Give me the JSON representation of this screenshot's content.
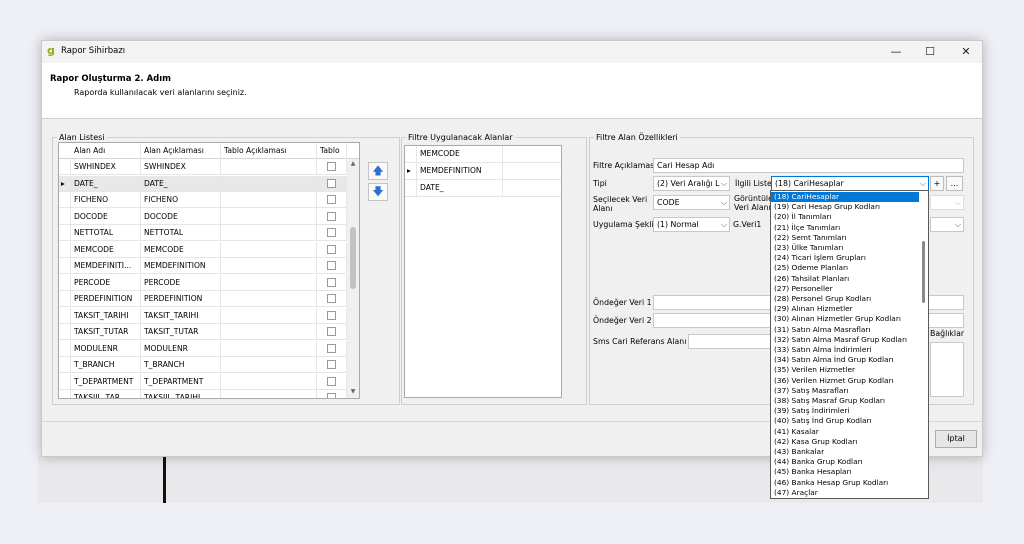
{
  "window": {
    "title": "Rapor Sihirbazı",
    "icon_letter": "g",
    "icons": [
      "minimize-icon",
      "maximize-icon",
      "close-icon"
    ],
    "minimize": "—",
    "maximize": "☐",
    "close": "✕"
  },
  "header": {
    "step_title": "Rapor Oluşturma 2. Adım",
    "step_desc": "Raporda kullanılacak veri alanlarını seçiniz."
  },
  "field_list": {
    "legend": "Alan Listesi",
    "columns": [
      "Alan Adı",
      "Alan Açıklaması",
      "Tablo Açıklaması",
      "Tablo"
    ],
    "rows": [
      {
        "name": "SWHINDEX",
        "desc": "SWHINDEX",
        "table_desc": "",
        "selected": false
      },
      {
        "name": "DATE_",
        "desc": "DATE_",
        "table_desc": "",
        "selected": true
      },
      {
        "name": "FICHENO",
        "desc": "FICHENO",
        "table_desc": "",
        "selected": false
      },
      {
        "name": "DOCODE",
        "desc": "DOCODE",
        "table_desc": "",
        "selected": false
      },
      {
        "name": "NETTOTAL",
        "desc": "NETTOTAL",
        "table_desc": "",
        "selected": false
      },
      {
        "name": "MEMCODE",
        "desc": "MEMCODE",
        "table_desc": "",
        "selected": false
      },
      {
        "name": "MEMDEFINITI...",
        "desc": "MEMDEFINITION",
        "table_desc": "",
        "selected": false
      },
      {
        "name": "PERCODE",
        "desc": "PERCODE",
        "table_desc": "",
        "selected": false
      },
      {
        "name": "PERDEFINITION",
        "desc": "PERDEFINITION",
        "table_desc": "",
        "selected": false
      },
      {
        "name": "TAKSIT_TARIHI",
        "desc": "TAKSIT_TARIHI",
        "table_desc": "",
        "selected": false
      },
      {
        "name": "TAKSIT_TUTAR",
        "desc": "TAKSIT_TUTAR",
        "table_desc": "",
        "selected": false
      },
      {
        "name": "MODULENR",
        "desc": "MODULENR",
        "table_desc": "",
        "selected": false
      },
      {
        "name": "T_BRANCH",
        "desc": "T_BRANCH",
        "table_desc": "",
        "selected": false
      },
      {
        "name": "T_DEPARTMENT",
        "desc": "T_DEPARTMENT",
        "table_desc": "",
        "selected": false
      },
      {
        "name": "TAKSIIL_TAR...",
        "desc": "TAKSIIL_TARIHI",
        "table_desc": "",
        "selected": false
      }
    ],
    "row_marker": "▸",
    "move_right_icon": "🡅",
    "move_down_icon": "🡇"
  },
  "filter_fields": {
    "legend": "Filtre Uygulanacak Alanlar",
    "rows": [
      {
        "name": "MEMCODE",
        "current": false
      },
      {
        "name": "MEMDEFINITION",
        "current": true
      },
      {
        "name": "DATE_",
        "current": false
      }
    ],
    "row_marker": "▸"
  },
  "filter_props": {
    "legend": "Filtre Alan Özellikleri",
    "desc_label": "Filtre Açıklaması",
    "desc_value": "Cari Hesap Adı",
    "type_label": "Tipi",
    "type_value": "(2) Veri Aralığı L",
    "related_list_label": "İlgili Liste",
    "related_list_value": "(18) CariHesaplar",
    "plus_button": "+",
    "more_button": "...",
    "selected_data_label_1": "Seçilecek Veri",
    "selected_data_label_2": "Alanı",
    "selected_data_value": "CODE",
    "display_label_1": "Görüntüle",
    "display_label_2": "Veri Alanı",
    "apply_label": "Uygulama Şekli",
    "apply_value": "(1) Normal",
    "gdata_label": "G.Veri1",
    "default1_label": "Öndeğer Veri 1",
    "default2_label": "Öndeğer Veri 2",
    "sms_label": "Sms Cari Referans Alanı",
    "headers_label": "Bağlıklar",
    "chevron": "⌵"
  },
  "dropdown_items": [
    "(18) CariHesaplar",
    "(19) Cari Hesap Grup Kodları",
    "(20) İl Tanımları",
    "(21) İlçe Tanımları",
    "(22) Semt Tanımları",
    "(23) Ülke Tanımları",
    "(24) Ticari İşlem Grupları",
    "(25) Odeme Planları",
    "(26) Tahsilat Planları",
    "(27) Personeller",
    "(28) Personel Grup Kodları",
    "(29) Alınan Hizmetler",
    "(30) Alınan Hizmetler Grup Kodları",
    "(31) Satın Alma Masrafları",
    "(32) Satın Alma Masraf Grup Kodları",
    "(33) Satın Alma İndirimleri",
    "(34) Satın Alma İnd Grup Kodları",
    "(35) Verilen Hizmetler",
    "(36) Verilen Hizmet Grup Kodları",
    "(37) Satış Masrafları",
    "(38) Satış Masraf Grup Kodları",
    "(39) Satış İndirimleri",
    "(40) Satış İnd Grup Kodları",
    "(41) Kasalar",
    "(42) Kasa Grup Kodları",
    "(43) Bankalar",
    "(44) Banka Grup Kodları",
    "(45) Banka Hesapları",
    "(46) Banka Hesap Grup Kodları",
    "(47) Araçlar"
  ],
  "footer": {
    "cancel_label": "İptal"
  }
}
